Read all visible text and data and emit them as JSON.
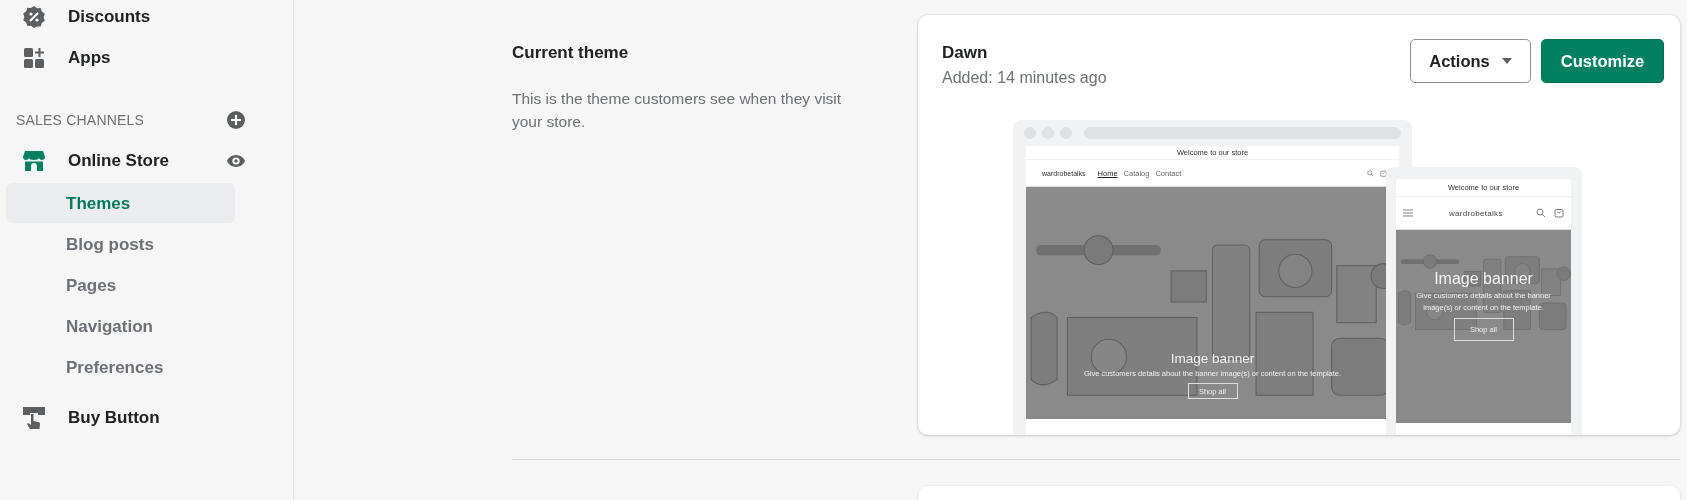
{
  "sidebar": {
    "items": [
      {
        "label": "Discounts",
        "kind": "discount"
      },
      {
        "label": "Apps",
        "kind": "apps"
      }
    ],
    "section": {
      "title": "SALES CHANNELS"
    },
    "channels": [
      {
        "label": "Online Store",
        "kind": "store",
        "children": [
          {
            "label": "Themes",
            "selected": true
          },
          {
            "label": "Blog posts",
            "selected": false
          },
          {
            "label": "Pages",
            "selected": false
          },
          {
            "label": "Navigation",
            "selected": false
          },
          {
            "label": "Preferences",
            "selected": false
          }
        ]
      },
      {
        "label": "Buy Button",
        "kind": "buy"
      }
    ]
  },
  "current_theme": {
    "heading": "Current theme",
    "description": "This is the theme customers see when they visit your store.",
    "card": {
      "name": "Dawn",
      "added": "Added: 14 minutes ago",
      "actions_button": "Actions",
      "customize_button": "Customize",
      "desktop_preview": {
        "announcement": "Welcome to our store",
        "store_name": "wardrobetalks",
        "nav": [
          {
            "label": "Home",
            "selected": true
          },
          {
            "label": "Catalog",
            "selected": false
          },
          {
            "label": "Contact",
            "selected": false
          }
        ],
        "banner_title": "Image banner",
        "banner_text": "Give customers details about the banner image(s) or content on the template.",
        "banner_button": "Shop all"
      },
      "mobile_preview": {
        "announcement": "Welcome to our store",
        "store_name": "wardrobetalks",
        "banner_title": "Image banner",
        "banner_text": "Give customers details about the banner image(s) or content on the template.",
        "banner_button": "Shop all"
      }
    }
  }
}
